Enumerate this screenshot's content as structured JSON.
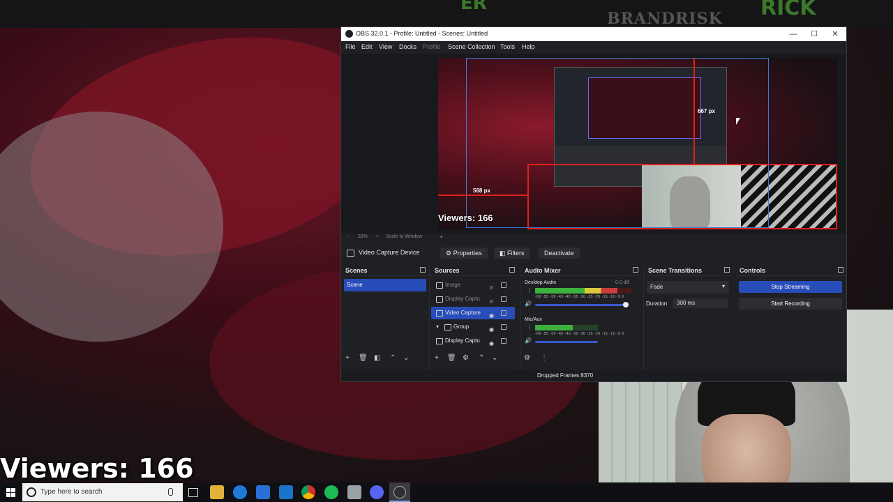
{
  "background": {
    "overlay_text_brand": "BRANDRISK",
    "overlay_text_green_right": "RICK",
    "overlay_text_green_left": "ER",
    "viewers_label": "Viewers: 166"
  },
  "obs": {
    "title": "OBS 32.0.1 - Profile: Untitled - Scenes: Untitled",
    "window_controls": {
      "minimize": "—",
      "maximize": "☐",
      "close": "✕"
    },
    "menu": [
      "File",
      "Edit",
      "View",
      "Docks",
      "Profile",
      "Scene Collection",
      "Tools",
      "Help"
    ],
    "preview": {
      "viewers": "Viewers: 166",
      "dim_horizontal": "568 px",
      "dim_vertical": "667 px"
    },
    "zoom": {
      "minus": "−",
      "level": "33%",
      "plus": "+",
      "mode": "Scale to Window"
    },
    "source_toolbar": {
      "selected_source": "Video Capture Device",
      "properties": "Properties",
      "filters": "Filters",
      "deactivate": "Deactivate"
    },
    "docks": {
      "scenes": {
        "title": "Scenes",
        "items": [
          "Scene"
        ]
      },
      "sources": {
        "title": "Sources",
        "items": [
          {
            "label": "Image",
            "visible": false
          },
          {
            "label": "Display Captu",
            "visible": false
          },
          {
            "label": "Video Capture",
            "visible": true,
            "selected": true
          },
          {
            "label": "Group",
            "visible": true
          },
          {
            "label": "Display Captu",
            "visible": true
          }
        ]
      },
      "audio_mixer": {
        "title": "Audio Mixer",
        "channels": [
          {
            "name": "Desktop Audio",
            "db": "0.0 dB"
          },
          {
            "name": "Mic/Aux",
            "db": ""
          }
        ],
        "ticks": "-60 -55 -50 -45 -40 -35 -30 -25 -20 -15 -10 -5 0"
      },
      "scene_transitions": {
        "title": "Scene Transitions",
        "transition": "Fade",
        "duration_label": "Duration",
        "duration_value": "300 ms"
      },
      "controls": {
        "title": "Controls",
        "stop_streaming": "Stop Streaming",
        "start_recording": "Start Recording"
      }
    },
    "status": {
      "dropped_frames": "Dropped Frames 8370"
    }
  },
  "taskbar": {
    "search_placeholder": "Type here to search"
  },
  "colors": {
    "accent": "#284cb8",
    "selection_red": "#e02020",
    "selection_blue": "#3a7bd5"
  }
}
